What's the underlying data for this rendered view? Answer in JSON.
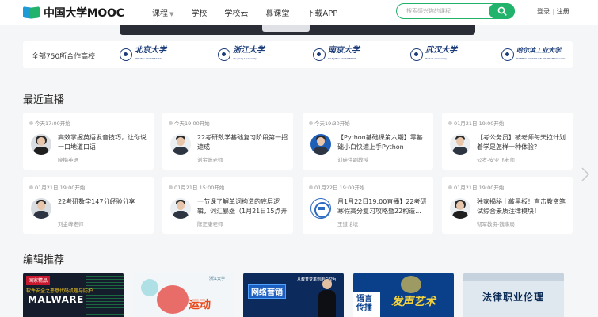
{
  "header": {
    "logo_text": "中国大学MOOC",
    "nav": [
      "课程",
      "学校",
      "学校云",
      "慕课堂",
      "下载APP"
    ],
    "search_placeholder": "搜索感兴趣的课程",
    "login": "登录",
    "separator": "|",
    "register": "注册"
  },
  "partners": {
    "label": "全部750所合作高校",
    "universities": [
      {
        "name": "北京大学",
        "en": "PEKING UNIVERSITY"
      },
      {
        "name": "浙江大学",
        "en": "Zhejiang University"
      },
      {
        "name": "南京大学",
        "en": "NANJING UNIVERSITY"
      },
      {
        "name": "武汉大学",
        "en": "Wuhan University"
      },
      {
        "name": "哈尔滨工业大学",
        "en": "HARBIN INSTITUTE OF TECHNOLOGY"
      }
    ]
  },
  "live": {
    "title": "最近直播",
    "cards": [
      {
        "time": "今天17:00开始",
        "title": "高效掌握英语发音技巧，让你说一口地道口语",
        "author": "晓梅英语"
      },
      {
        "time": "今天19:00开始",
        "title": "22考研数学基础复习阶段第一招速成",
        "author": "刘金峰老师"
      },
      {
        "time": "今天19:30开始",
        "title": "【Python基础课第六期】零基础小白快速上手Python",
        "author": "刘硅伟副教授"
      },
      {
        "time": "01月21日 19:00开始",
        "title": "【考公务员】被老师每天拉计划着学是怎样一种体验？",
        "author": "公考-安亚飞老师"
      },
      {
        "time": "01月21日 19:00开始",
        "title": "22考研数学147分经验分享",
        "author": "刘金峰老师"
      },
      {
        "time": "01月21日 15:00开始",
        "title": "一节课了解单词构造的底层逻辑，词汇暴涨（1月21日15点开",
        "author": "陈正康老师"
      },
      {
        "time": "01月22日 19:00开始",
        "title": "月1月22日19:00直播】22考研寒假高分复习攻略暨22构造...",
        "author": "王道论坛"
      },
      {
        "time": "01月21日 19:00开始",
        "title": "独家揭秘｜敲黑板！直击教资笔试综合素质注律模块！",
        "author": "彻军教资-魏事局"
      }
    ]
  },
  "picks": {
    "title": "编辑推荐",
    "items": [
      {
        "tag": "国家精品",
        "line1": "软件安全之恶意代码机理与防护",
        "line2": "MALWARE"
      },
      {
        "badge": "浙江大学",
        "line1": "运动"
      },
      {
        "line1": "网络营销",
        "line2": "从教育变革到用户交互"
      },
      {
        "line1": "语言传播",
        "line2": "发声艺术"
      },
      {
        "line1": "法律职业伦理"
      }
    ]
  },
  "colors": {
    "brand_green": "#21b36b",
    "dark_navy": "#1d3d7a"
  }
}
